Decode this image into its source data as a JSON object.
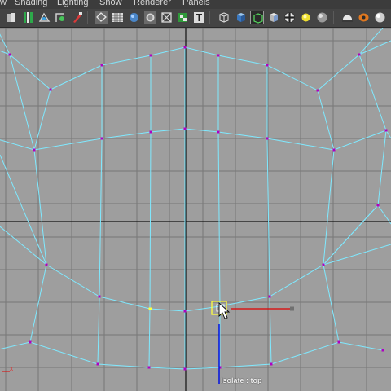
{
  "menu": {
    "items": [
      {
        "label": "w"
      },
      {
        "label": "Shading"
      },
      {
        "label": "Lighting"
      },
      {
        "label": "Show"
      },
      {
        "label": "Renderer"
      },
      {
        "label": "Panels"
      }
    ]
  },
  "toolbar": {
    "icons": [
      "camera-attributes-icon",
      "bookmark-icon",
      "image-plane-icon",
      "2d-pan-icon",
      "wireframe-icon",
      "grid-icon",
      "smooth-shade-icon",
      "isolate-icon",
      "xray-icon",
      "textured-icon",
      "text-icon",
      "wireframe-cube-icon",
      "shaded-cube-icon",
      "selected-wireframe-icon",
      "box-icon",
      "checker-icon",
      "light-icon",
      "sphere-icon",
      "shadow-icon",
      "render-icon",
      "lights-sphere-icon"
    ]
  },
  "viewport": {
    "isolate_label": "Isolate : top",
    "axis_x_label": "x",
    "colors": {
      "background": "#9e9e9e",
      "grid": "#777777",
      "axis": "#111111",
      "wire": "#7fe9ff",
      "vertex": "#b000c0",
      "selected_vertex": "#ffff40",
      "manipulator_x": "#e00000",
      "manipulator_y": "#0010e0"
    }
  }
}
